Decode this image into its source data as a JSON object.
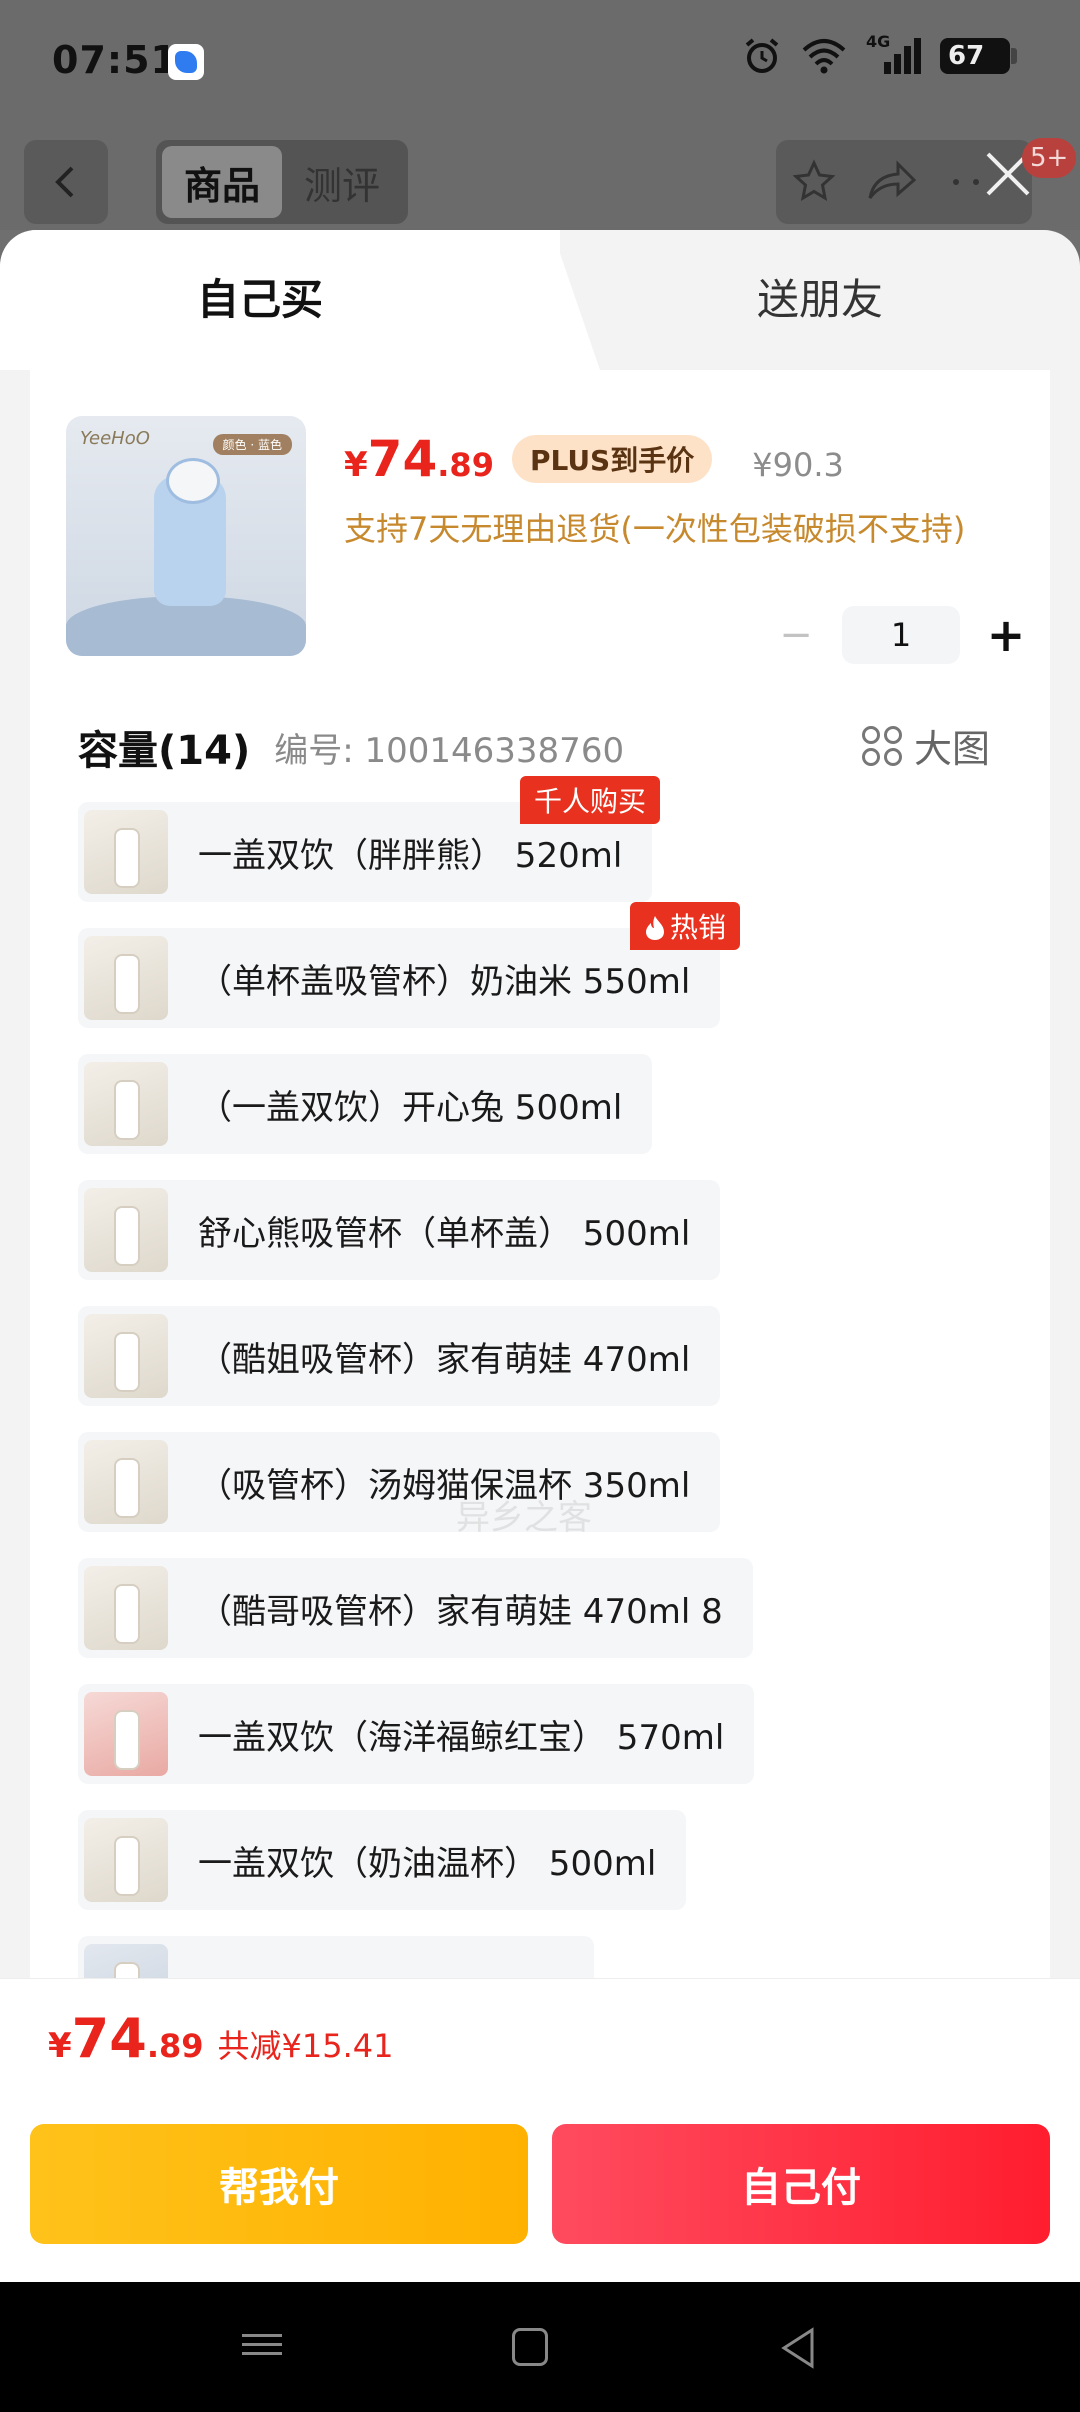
{
  "status_bar": {
    "time": "07:51",
    "network": "4G",
    "battery": "67",
    "icons": [
      "app-notification-icon",
      "alarm-icon",
      "wifi-icon",
      "cell-signal-icon",
      "battery-icon"
    ]
  },
  "header": {
    "tabs": [
      {
        "label": "商品",
        "active": true
      },
      {
        "label": "测评",
        "active": false
      }
    ],
    "notification_badge": "5+"
  },
  "sheet": {
    "tabs": {
      "self": "自己买",
      "friend": "送朋友"
    },
    "product": {
      "image_brand": "YeeHoO",
      "image_tag": "颜色 · 蓝色",
      "price_currency": "¥",
      "price_int": "74",
      "price_dec": ".89",
      "plus_label": "PLUS到手价",
      "original_price": "¥90.3",
      "return_note": "支持7天无理由退货(一次性包装破损不支持)",
      "quantity": "1",
      "qty_minus": "−",
      "qty_plus": "+"
    },
    "section": {
      "title": "容量(14)",
      "code": "编号: 100146338760",
      "big_image_label": "大图"
    },
    "options": [
      {
        "label": "一盖双饮（胖胖熊） 520ml",
        "badge": "千人购买"
      },
      {
        "label": "（单杯盖吸管杯）奶油米 550ml",
        "badge": "热销"
      },
      {
        "label": "（一盖双饮）开心兔 500ml",
        "badge": ""
      },
      {
        "label": "舒心熊吸管杯（单杯盖） 500ml",
        "badge": ""
      },
      {
        "label": "（酷姐吸管杯）家有萌娃 470ml",
        "badge": ""
      },
      {
        "label": "（吸管杯）汤姆猫保温杯 350ml",
        "badge": ""
      },
      {
        "label": "（酷哥吸管杯）家有萌娃 470ml 8",
        "badge": ""
      },
      {
        "label": "一盖双饮（海洋福鲸红宝） 570ml",
        "badge": ""
      },
      {
        "label": "一盖双饮（奶油温杯） 500ml",
        "badge": ""
      },
      {
        "label": "",
        "badge": ""
      }
    ],
    "watermark": "异乡之客"
  },
  "footer": {
    "price_currency": "¥",
    "price_int": "74",
    "price_dec": ".89",
    "saving": "共减¥15.41",
    "help_pay": "帮我付",
    "self_pay": "自己付"
  },
  "colors": {
    "accent_red": "#e8241c",
    "gold": "#c7892d",
    "help_button": "#ffb100",
    "pay_button": "#ff1d2e"
  }
}
